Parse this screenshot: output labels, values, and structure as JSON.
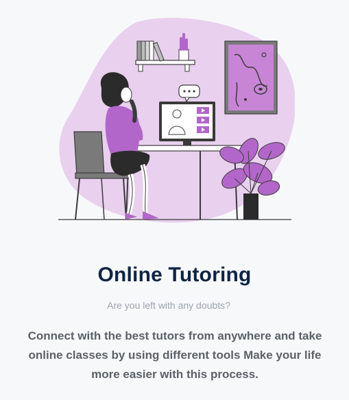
{
  "card": {
    "title": "Online Tutoring",
    "subtitle": "Are you left with any doubts?",
    "description": "Connect with the best tutors from anywhere and take online classes by using different tools Make your life more easier with this process."
  },
  "colors": {
    "accent_purple": "#b366c9",
    "blob_lilac": "#e9d0ee",
    "title_navy": "#0e2444",
    "body_gray": "#5b6168",
    "muted_gray": "#9aa3b0",
    "background": "#f7f8fa"
  },
  "illustration": {
    "icon": "online-tutoring-illustration"
  }
}
